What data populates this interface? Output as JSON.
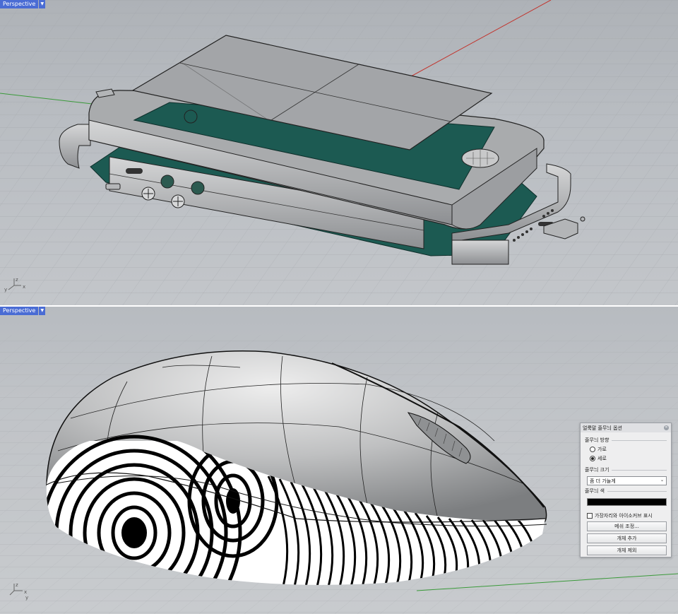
{
  "viewport_top": {
    "label": "Perspective"
  },
  "viewport_bottom": {
    "label": "Perspective"
  },
  "axis_labels": {
    "x": "x",
    "y": "y",
    "z": "z"
  },
  "dialog": {
    "title": "얼룩말 줄무늬 옵션",
    "direction_label": "줄무늬 방향",
    "direction_options": [
      "가로",
      "세로"
    ],
    "direction_selected": "세로",
    "size_label": "줄무늬 크기",
    "size_value": "좀 더 가늘게",
    "color_label": "줄무늬 색",
    "color_value": "#000000",
    "show_edges_label": "가장자리와 아이소커브 표시",
    "show_edges_checked": false,
    "mesh_button": "메쉬 조정...",
    "add_button": "개체 추가",
    "remove_button": "개체 제외"
  },
  "colors": {
    "label_bg": "#4a6cd4",
    "pcb": "#1c5a52",
    "phone_body": "#a9abad",
    "x_axis": "#c2352e",
    "y_axis": "#3a9a3a"
  }
}
